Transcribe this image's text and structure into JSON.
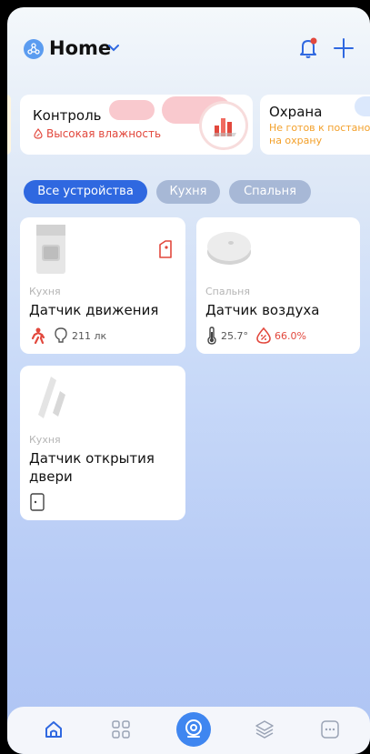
{
  "header": {
    "title": "Home",
    "logo_icon": "home-network-icon",
    "dropdown_icon": "chevron-down-icon",
    "notify_icon": "bell-alert-icon",
    "add_icon": "plus-icon"
  },
  "scenes": [
    {
      "title": "Контроль",
      "subtitle": "Высокая влажность",
      "subtitle_icon": "humidity-drop-icon",
      "icon": "chart-bars-icon",
      "subtitle_color": "#e2483d"
    },
    {
      "title": "Охрана",
      "subtitle_line1": "Не готов к постано",
      "subtitle_line2": "на охрану",
      "subtitle_color": "#f3a02a"
    }
  ],
  "tabs": [
    {
      "label": "Все устройства",
      "active": true
    },
    {
      "label": "Кухня",
      "active": false
    },
    {
      "label": "Спальня",
      "active": false
    }
  ],
  "devices": [
    {
      "room": "Кухня",
      "name": "Датчик движения",
      "image": "motion-sensor-image",
      "badge_icon": "battery-low-icon",
      "stats": [
        {
          "icon": "person-motion-icon",
          "value": ""
        },
        {
          "icon": "light-bulb-icon",
          "value": "211 лк"
        }
      ]
    },
    {
      "room": "Спальня",
      "name": "Датчик воздуха",
      "image": "air-sensor-image",
      "stats": [
        {
          "icon": "thermometer-icon",
          "value": "25.7°"
        },
        {
          "icon": "humidity-drop-icon",
          "value": "66.0%"
        }
      ]
    },
    {
      "room": "Кухня",
      "name_line1": "Датчик открытия",
      "name_line2": "двери",
      "image": "door-sensor-image",
      "stats": [
        {
          "icon": "door-closed-icon",
          "value": ""
        }
      ]
    }
  ],
  "nav": [
    {
      "icon": "home-icon",
      "active": true
    },
    {
      "icon": "grid-icon",
      "active": false
    },
    {
      "icon": "camera-center-icon",
      "active": false
    },
    {
      "icon": "layers-icon",
      "active": false
    },
    {
      "icon": "more-icon",
      "active": false
    }
  ],
  "colors": {
    "accent": "#2f68e0",
    "alert_red": "#e2483d",
    "warning_orange": "#f3a02a",
    "tab_inactive": "#a7b8d6"
  }
}
